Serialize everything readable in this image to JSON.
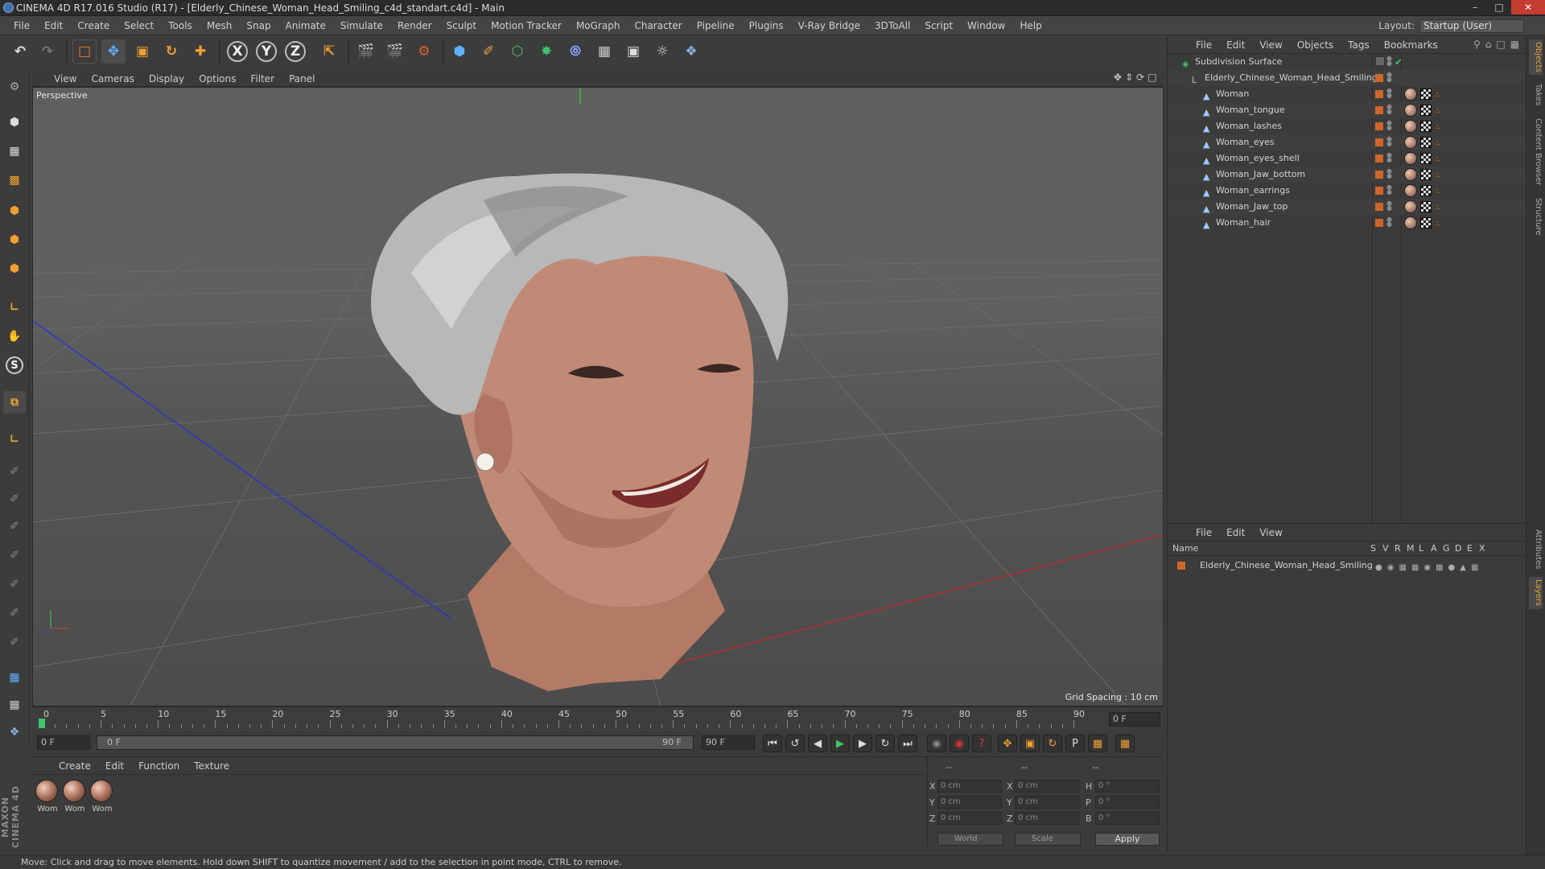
{
  "window": {
    "title": "CINEMA 4D R17.016 Studio (R17) - [Elderly_Chinese_Woman_Head_Smiling_c4d_standart.c4d] - Main"
  },
  "menu": [
    "File",
    "Edit",
    "Create",
    "Select",
    "Tools",
    "Mesh",
    "Snap",
    "Animate",
    "Simulate",
    "Render",
    "Sculpt",
    "Motion Tracker",
    "MoGraph",
    "Character",
    "Pipeline",
    "Plugins",
    "V-Ray Bridge",
    "3DToAll",
    "Script",
    "Window",
    "Help"
  ],
  "layout": {
    "label": "Layout:",
    "value": "Startup (User)"
  },
  "toolbar": {
    "axis_x": "X",
    "axis_y": "Y",
    "axis_z": "Z"
  },
  "left_tools": {
    "s_label": "S"
  },
  "viewport": {
    "menu": [
      "View",
      "Cameras",
      "Display",
      "Options",
      "Filter",
      "Panel"
    ],
    "camera_label": "Perspective",
    "grid_spacing": "Grid Spacing : 10 cm"
  },
  "timeline": {
    "ticks": [
      "0",
      "5",
      "10",
      "15",
      "20",
      "25",
      "30",
      "35",
      "40",
      "45",
      "50",
      "55",
      "60",
      "65",
      "70",
      "75",
      "80",
      "85",
      "90"
    ],
    "current_frame_field": "0 F",
    "start_field": "0 F",
    "range_start": "0 F",
    "range_end": "90 F",
    "end_field": "90 F"
  },
  "materials": {
    "menu": [
      "Create",
      "Edit",
      "Function",
      "Texture"
    ],
    "items": [
      "Wom",
      "Wom",
      "Wom"
    ]
  },
  "coordinates": {
    "header": [
      "--",
      "--",
      "--"
    ],
    "rows": [
      {
        "l1": "X",
        "v1": "0 cm",
        "l2": "X",
        "v2": "0 cm",
        "l3": "H",
        "v3": "0 °"
      },
      {
        "l1": "Y",
        "v1": "0 cm",
        "l2": "Y",
        "v2": "0 cm",
        "l3": "P",
        "v3": "0 °"
      },
      {
        "l1": "Z",
        "v1": "0 cm",
        "l2": "Z",
        "v2": "0 cm",
        "l3": "B",
        "v3": "0 °"
      }
    ],
    "mode": "World",
    "transform": "Scale",
    "apply": "Apply"
  },
  "object_manager": {
    "menu": [
      "File",
      "Edit",
      "View",
      "Objects",
      "Tags",
      "Bookmarks"
    ],
    "objects": [
      {
        "name": "Subdivision Surface"
      },
      {
        "name": "Elderly_Chinese_Woman_Head_Smiling"
      },
      {
        "name": "Woman"
      },
      {
        "name": "Woman_tongue"
      },
      {
        "name": "Woman_lashes"
      },
      {
        "name": "Woman_eyes"
      },
      {
        "name": "Woman_eyes_shell"
      },
      {
        "name": "Woman_Jaw_bottom"
      },
      {
        "name": "Woman_earrings"
      },
      {
        "name": "Woman_Jaw_top"
      },
      {
        "name": "Woman_hair"
      }
    ]
  },
  "layer_manager": {
    "menu": [
      "File",
      "Edit",
      "View"
    ],
    "columns": [
      "Name",
      "S",
      "V",
      "R",
      "M",
      "L",
      "A",
      "G",
      "D",
      "E",
      "X"
    ],
    "layers": [
      "Elderly_Chinese_Woman_Head_Smiling"
    ]
  },
  "right_tabs": [
    "Objects",
    "Takes",
    "Content Browser",
    "Structure",
    "Attributes",
    "Layers"
  ],
  "status": "Move: Click and drag to move elements. Hold down SHIFT to quantize movement / add to the selection in point mode, CTRL to remove.",
  "brand": "MAXON CINEMA 4D",
  "colors": {
    "accent_orange": "#d0652a",
    "x_axis_line": "#b03030",
    "z_axis_line": "#3030c0",
    "y_axis_line": "#30c030"
  }
}
